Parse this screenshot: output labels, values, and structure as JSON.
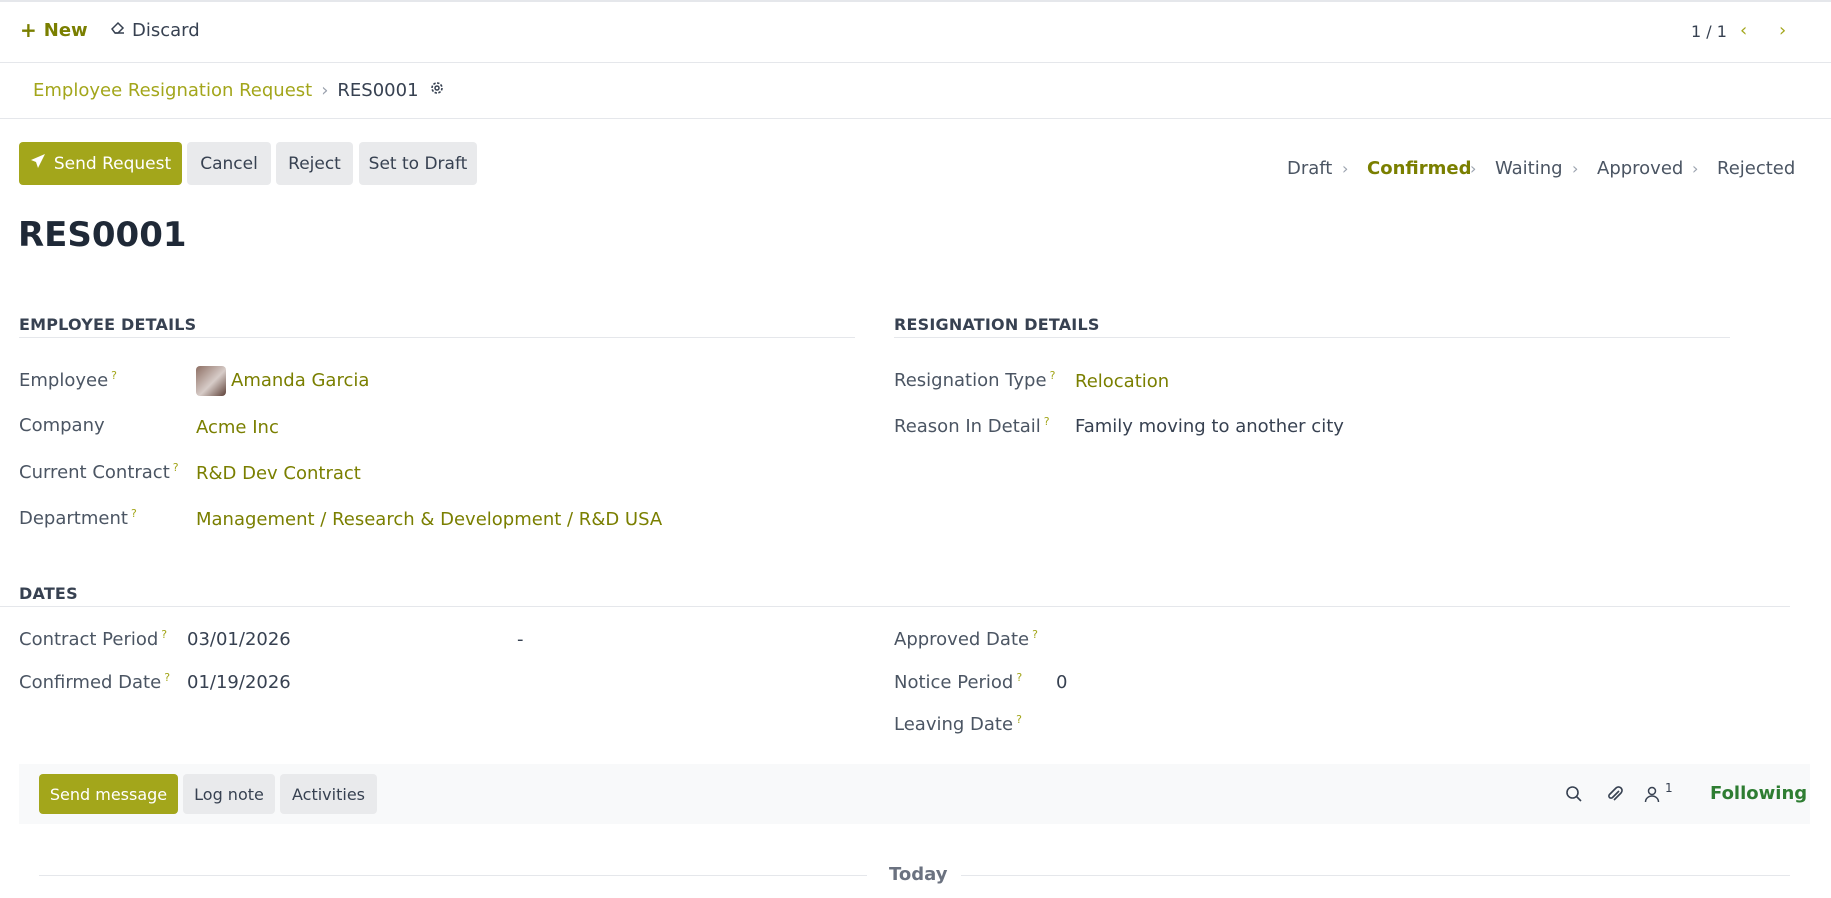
{
  "toolbar": {
    "new_label": "New",
    "discard_label": "Discard",
    "pager": "1 / 1"
  },
  "breadcrumb": {
    "parent": "Employee Resignation Request",
    "current": "RES0001"
  },
  "actions": {
    "send_request": "Send Request",
    "cancel": "Cancel",
    "reject": "Reject",
    "set_to_draft": "Set to Draft"
  },
  "statusbar": {
    "stages": [
      "Draft",
      "Confirmed",
      "Waiting",
      "Approved",
      "Rejected"
    ],
    "active": "Confirmed"
  },
  "record": {
    "title": "RES0001"
  },
  "employee_details": {
    "heading": "EMPLOYEE DETAILS",
    "employee_label": "Employee",
    "employee_value": "Amanda Garcia",
    "company_label": "Company",
    "company_value": "Acme Inc",
    "contract_label": "Current Contract",
    "contract_value": "R&D Dev Contract",
    "department_label": "Department",
    "department_value": "Management / Research & Development / R&D USA"
  },
  "resignation_details": {
    "heading": "RESIGNATION DETAILS",
    "type_label": "Resignation Type",
    "type_value": "Relocation",
    "reason_label": "Reason In Detail",
    "reason_value": "Family moving to another city"
  },
  "dates": {
    "heading": "DATES",
    "contract_period_label": "Contract Period",
    "contract_period_start": "03/01/2026",
    "contract_period_sep": "-",
    "confirmed_date_label": "Confirmed Date",
    "confirmed_date_value": "01/19/2026",
    "approved_date_label": "Approved Date",
    "notice_period_label": "Notice Period",
    "notice_period_value": "0",
    "leaving_date_label": "Leaving Date"
  },
  "chatter": {
    "send_message": "Send message",
    "log_note": "Log note",
    "activities": "Activities",
    "followers_count": "1",
    "following": "Following",
    "today": "Today"
  },
  "colors": {
    "accent": "#a3a61b",
    "link": "#7a7f00",
    "following": "#2e7d32"
  },
  "help_mark": "?"
}
